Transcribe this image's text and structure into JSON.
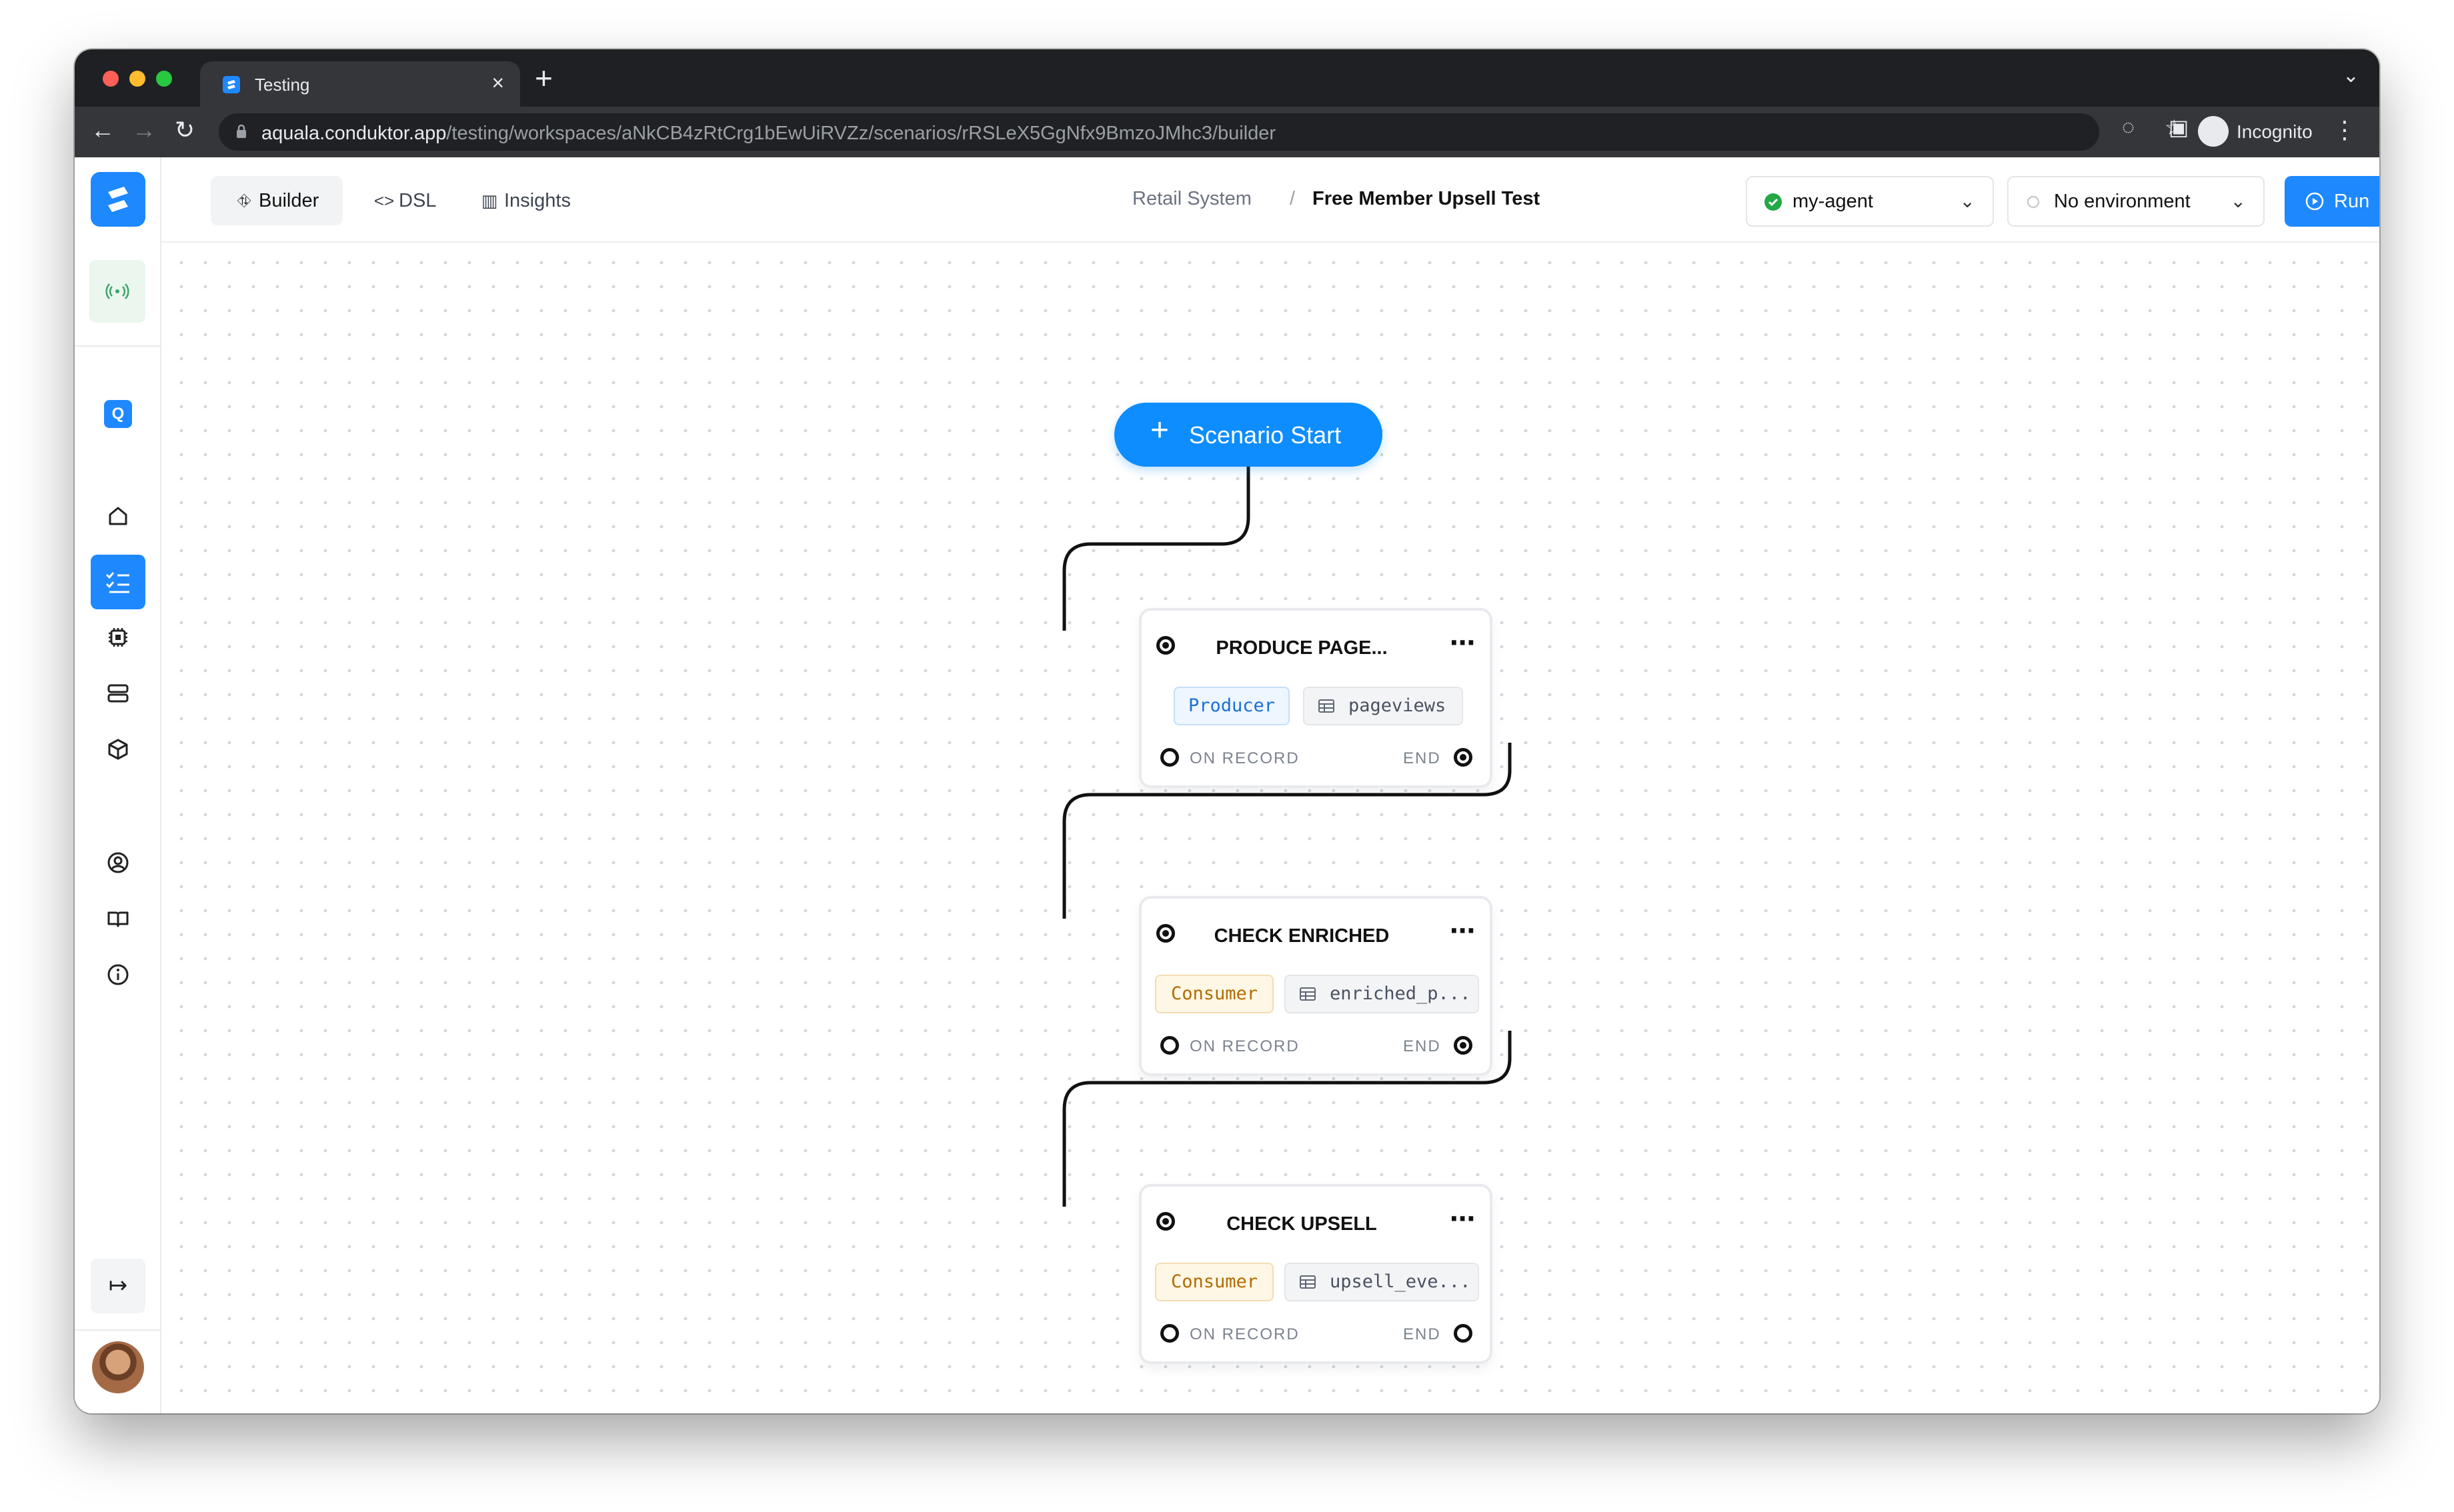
{
  "browser": {
    "tab_title": "Testing",
    "url_host": "aquala.conduktor.app",
    "url_path": "/testing/workspaces/aNkCB4zRtCrg1bEwUiRVZz/scenarios/rRSLeX5GgNfx9BmzoJMhc3/builder",
    "incognito_label": "Incognito"
  },
  "toolbar": {
    "tabs": [
      {
        "label": "Builder",
        "icon": "workflow-icon",
        "active": true
      },
      {
        "label": "DSL",
        "icon": "code-icon",
        "active": false
      },
      {
        "label": "Insights",
        "icon": "bar-chart-icon",
        "active": false
      }
    ],
    "breadcrumb": {
      "parent": "Retail System",
      "separator": "/",
      "current": "Free Member Upsell Test"
    },
    "agent_select": {
      "value": "my-agent",
      "status_color": "#22a845"
    },
    "environment_select": {
      "value": "No environment"
    },
    "run_label": "Run"
  },
  "sidebar": {
    "items": [
      "live-icon",
      "q-badge",
      "home-icon",
      "checklist-icon",
      "chip-icon",
      "server-icon",
      "box-icon",
      "user-circle-icon",
      "book-icon",
      "info-icon"
    ],
    "active_item": "checklist-icon",
    "q_badge_label": "Q"
  },
  "canvas": {
    "start_label": "Scenario Start",
    "start_icon": "plus-icon",
    "nodes": [
      {
        "title": "PRODUCE PAGE...",
        "role": "Producer",
        "topic": "pageviews",
        "left_port": "ON RECORD",
        "right_port": "END"
      },
      {
        "title": "CHECK ENRICHED",
        "role": "Consumer",
        "topic": "enriched_p...",
        "left_port": "ON RECORD",
        "right_port": "END"
      },
      {
        "title": "CHECK UPSELL",
        "role": "Consumer",
        "topic": "upsell_eve...",
        "left_port": "ON RECORD",
        "right_port": "END"
      }
    ]
  },
  "colors": {
    "accent": "#1e88ff",
    "start_button": "#0d8dff",
    "producer": "#1a6fd6",
    "consumer": "#b36b00",
    "chat_fab": "#4f46e5"
  }
}
